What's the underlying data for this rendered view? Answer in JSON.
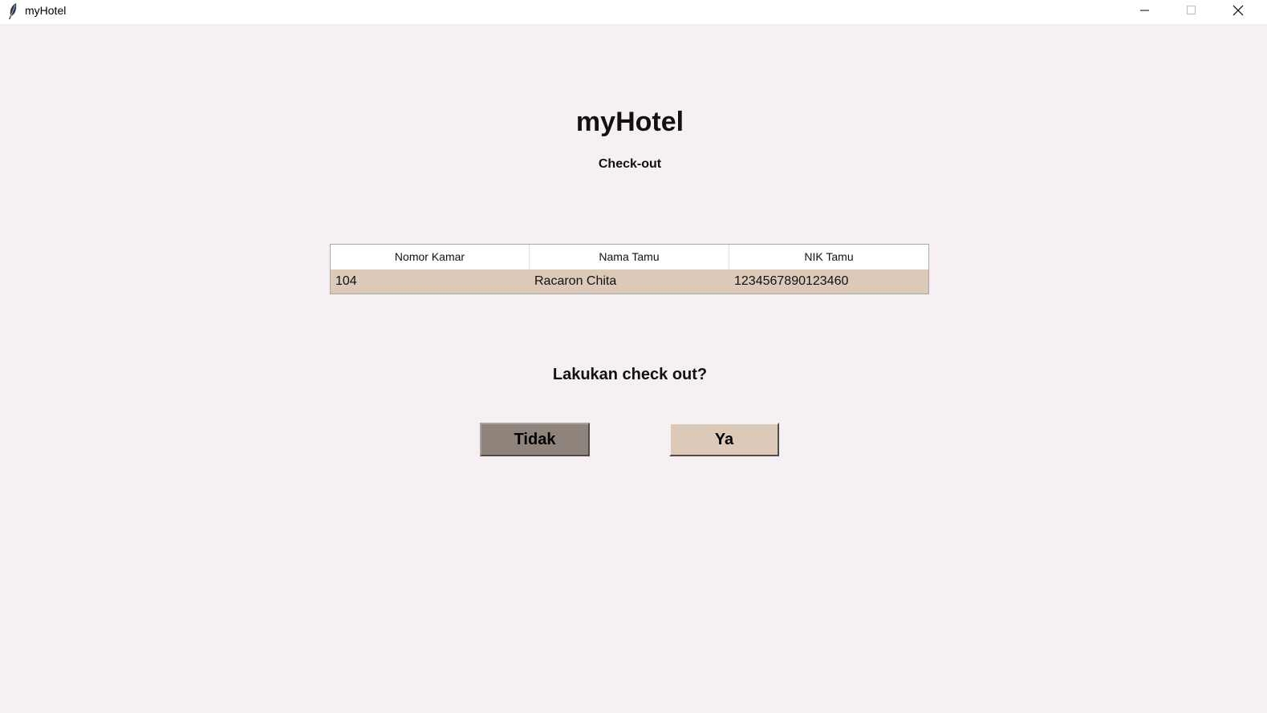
{
  "window": {
    "title": "myHotel"
  },
  "page": {
    "heading": "myHotel",
    "subheading": "Check-out",
    "question": "Lakukan check out?"
  },
  "table": {
    "columns": [
      "Nomor Kamar",
      "Nama Tamu",
      "NIK Tamu"
    ],
    "rows": [
      [
        "104",
        "Racaron Chita",
        "1234567890123460"
      ]
    ]
  },
  "buttons": {
    "no_label": "Tidak",
    "yes_label": "Ya"
  },
  "colors": {
    "background": "#f6eff4",
    "row_highlight": "#ddc9b8",
    "button_no": "#8e847b",
    "button_yes": "#ddc9b8"
  },
  "icons": {
    "app": "feather-icon",
    "minimize": "minimize-icon",
    "maximize": "maximize-icon",
    "close": "close-icon"
  }
}
